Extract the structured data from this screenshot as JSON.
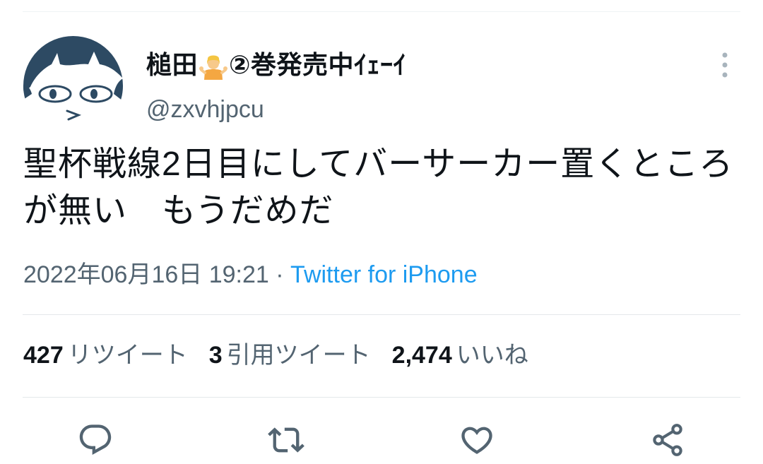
{
  "user": {
    "display_name_pre": "槌田",
    "display_name_post": "②巻発売中ｲｪｰｲ",
    "handle": "@zxvhjpcu"
  },
  "tweet": {
    "text": "聖杯戦線2日目にしてバーサーカー置くところが無い　もうだめだ",
    "timestamp": "2022年06月16日 19:21",
    "separator": "·",
    "source": "Twitter for iPhone"
  },
  "stats": {
    "retweets_count": "427",
    "retweets_label": "リツイート",
    "quotes_count": "3",
    "quotes_label": "引用ツイート",
    "likes_count": "2,474",
    "likes_label": "いいね"
  },
  "icons": {
    "emoji": "person-shrugging-emoji",
    "more": "more-vertical-icon",
    "reply": "reply-icon",
    "retweet": "retweet-icon",
    "like": "heart-icon",
    "share": "share-icon"
  },
  "colors": {
    "text": "#0f1419",
    "secondary": "#536471",
    "link": "#1d9bf0",
    "avatar_dark": "#2d4a63"
  }
}
